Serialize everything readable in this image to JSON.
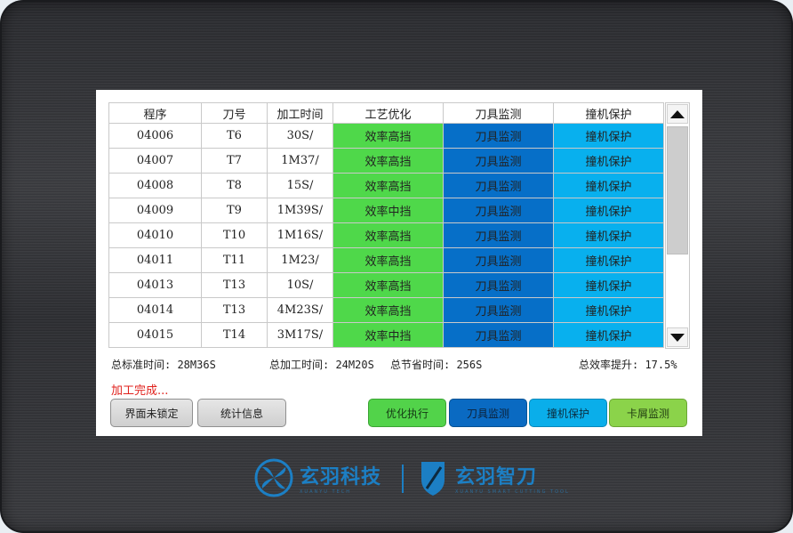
{
  "table": {
    "headers": [
      "程序",
      "刀号",
      "加工时间",
      "工艺优化",
      "刀具监测",
      "撞机保护"
    ],
    "rows": [
      {
        "program": "04006",
        "tool": "T6",
        "time": "30S/",
        "opt": "效率高挡",
        "monitor": "刀具监测",
        "protect": "撞机保护"
      },
      {
        "program": "04007",
        "tool": "T7",
        "time": "1M37/",
        "opt": "效率高挡",
        "monitor": "刀具监测",
        "protect": "撞机保护"
      },
      {
        "program": "04008",
        "tool": "T8",
        "time": "15S/",
        "opt": "效率高挡",
        "monitor": "刀具监测",
        "protect": "撞机保护"
      },
      {
        "program": "04009",
        "tool": "T9",
        "time": "1M39S/",
        "opt": "效率中挡",
        "monitor": "刀具监测",
        "protect": "撞机保护"
      },
      {
        "program": "04010",
        "tool": "T10",
        "time": "1M16S/",
        "opt": "效率高挡",
        "monitor": "刀具监测",
        "protect": "撞机保护"
      },
      {
        "program": "04011",
        "tool": "T11",
        "time": "1M23/",
        "opt": "效率高挡",
        "monitor": "刀具监测",
        "protect": "撞机保护"
      },
      {
        "program": "04013",
        "tool": "T13",
        "time": "10S/",
        "opt": "效率高挡",
        "monitor": "刀具监测",
        "protect": "撞机保护"
      },
      {
        "program": "04014",
        "tool": "T13",
        "time": "4M23S/",
        "opt": "效率高挡",
        "monitor": "刀具监测",
        "protect": "撞机保护"
      },
      {
        "program": "04015",
        "tool": "T14",
        "time": "3M17S/",
        "opt": "效率中挡",
        "monitor": "刀具监测",
        "protect": "撞机保护"
      }
    ]
  },
  "summary": {
    "standard_time": "总标准时间: 28M36S",
    "process_time": "总加工时间: 24M20S",
    "saved_time": "总节省时间: 256S",
    "efficiency": "总效率提升: 17.5%"
  },
  "status_text": "加工完成...",
  "buttons": {
    "lock": "界面未锁定",
    "stats": "统计信息",
    "optimize": "优化执行",
    "tool_monitor": "刀具监测",
    "collision": "撞机保护",
    "chip_monitor": "卡屑监测"
  },
  "scrollbar": {
    "up_icon": "triangle-up-icon",
    "down_icon": "triangle-down-icon"
  },
  "logos": {
    "left_text": "玄羽科技",
    "left_sub": "XUANYU TECH",
    "right_text": "玄羽智刀",
    "right_sub": "XUANYU SMART CUTTING TOOL"
  },
  "colors": {
    "optimize": "#4fd84a",
    "tool_monitor": "#066fc8",
    "collision": "#08b0ee",
    "chip": "#8bd34a",
    "status": "#e0221d"
  }
}
